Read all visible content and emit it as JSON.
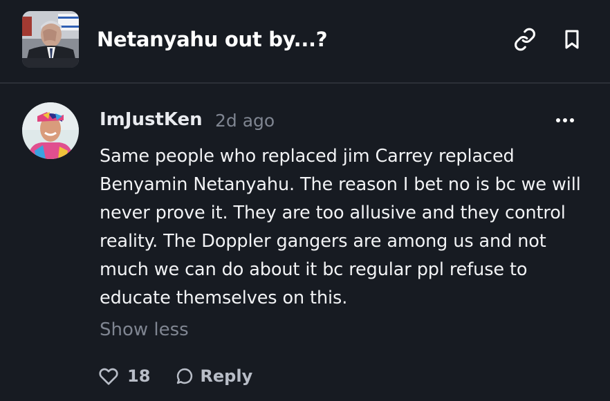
{
  "header": {
    "market_title": "Netanyahu out by...?",
    "link_icon": "link-icon",
    "bookmark_icon": "bookmark-icon"
  },
  "comment": {
    "author": "ImJustKen",
    "timestamp": "2d ago",
    "more_icon": "more-horizontal-icon",
    "body": "Same people who replaced jim Carrey replaced Benyamin Netanyahu. The reason I bet no is bc we will never prove it. They are too allusive and they control reality. The Doppler gangers are among us and not much we can do about it bc regular ppl refuse to educate themselves on this.",
    "toggle_label": "Show less",
    "likes": "18",
    "reply_label": "Reply"
  },
  "colors": {
    "background": "#171b22",
    "divider": "#2c3038",
    "muted_text": "#7f8591",
    "action_text": "#b8bdc7"
  }
}
